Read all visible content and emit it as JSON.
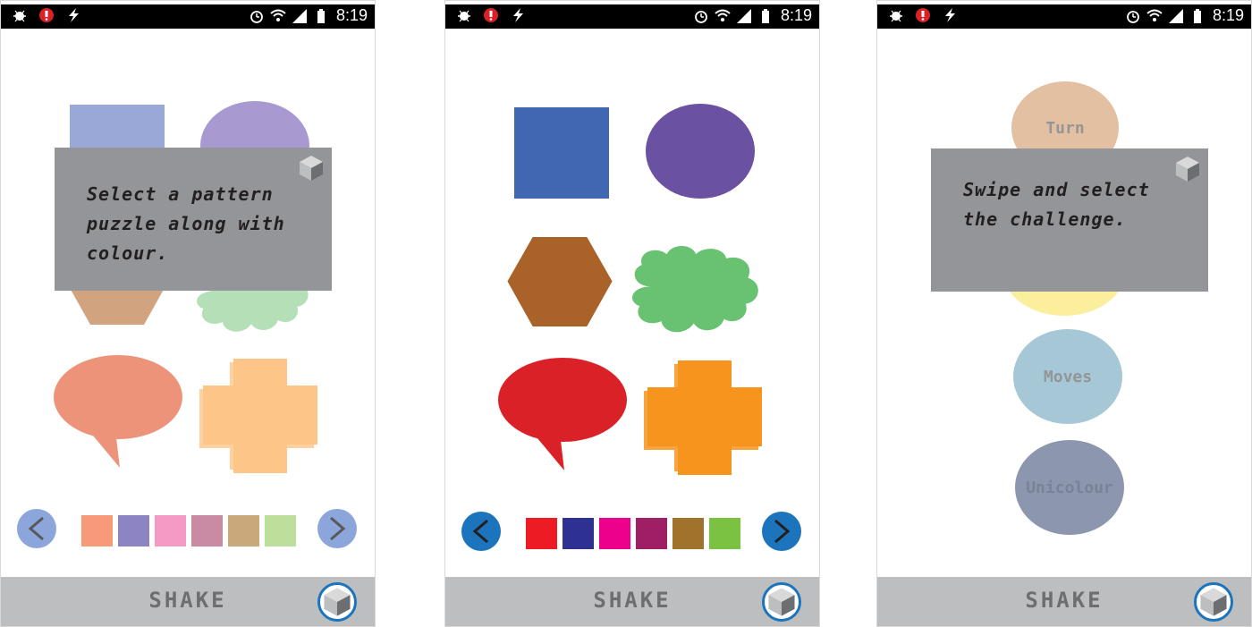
{
  "status_bar": {
    "time": "8:19"
  },
  "bottom_bar": {
    "label": "SHAKE"
  },
  "phones": [
    {
      "overlay_text": "Select a pattern puzzle along with colour.",
      "swatches": [
        "#f79a7a",
        "#8c84c3",
        "#f59ac4",
        "#c98aa3",
        "#c9a87c",
        "#bedf9c"
      ]
    },
    {
      "swatches": [
        "#ed1c24",
        "#2e3192",
        "#ec008c",
        "#9e1f63",
        "#a0722c",
        "#7cc242"
      ]
    },
    {
      "overlay_text": "Swipe and select the challenge.",
      "challenges": [
        "Turn",
        "Moves",
        "Unicolour"
      ]
    }
  ],
  "colors": {
    "square_dim": "#9aa8d8",
    "square": "#4267b2",
    "ellipse_dim": "#a89ad0",
    "ellipse": "#6b51a2",
    "hexagon_dim": "#d1a47f",
    "hexagon": "#a96228",
    "cloud_dim": "#b5e0b7",
    "cloud": "#69c272",
    "bubble_dim": "#ec937a",
    "bubble": "#da2128",
    "cross_dim": "#fdc688",
    "cross": "#f7941e",
    "nav_dim": "#8ca6dc",
    "nav": "#1c75bc",
    "overlay": "#939598",
    "turn_oval": "#e4c0a2",
    "yellow_oval": "#fbee9c",
    "moves_oval": "#a6c8d6",
    "unicolour_oval": "#8c96ae",
    "bottom_bar": "#bcbec0"
  },
  "icons": [
    "bug-icon",
    "record-icon",
    "lightning-icon",
    "alarm-icon",
    "wifi-icon",
    "signal-icon",
    "battery-icon",
    "cube-icon",
    "chevron-left-icon",
    "chevron-right-icon"
  ]
}
